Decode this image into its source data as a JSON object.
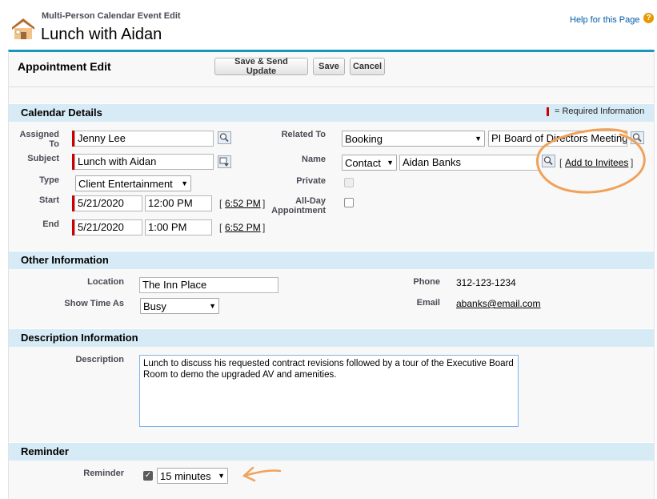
{
  "header": {
    "subtitle": "Multi-Person Calendar Event Edit",
    "title": "Lunch with Aidan",
    "help_link": "Help for this Page",
    "help_icon": "?"
  },
  "toolbar": {
    "title": "Appointment Edit",
    "save_send_label": "Save & Send Update",
    "save_label": "Save",
    "cancel_label": "Cancel"
  },
  "calendar_details": {
    "title": "Calendar Details",
    "required_legend": "= Required Information",
    "assigned_to_label": "Assigned To",
    "assigned_to_value": "Jenny Lee",
    "subject_label": "Subject",
    "subject_value": "Lunch with Aidan",
    "type_label": "Type",
    "type_value": "Client Entertainment",
    "start_label": "Start",
    "start_date": "5/21/2020",
    "start_time": "12:00 PM",
    "start_now": "6:52 PM",
    "end_label": "End",
    "end_date": "5/21/2020",
    "end_time": "1:00 PM",
    "end_now": "6:52 PM",
    "related_to_label": "Related To",
    "related_to_type": "Booking",
    "related_to_value": "PI Board of Directors Meeting",
    "name_label": "Name",
    "name_type": "Contact",
    "name_value": "Aidan Banks",
    "add_invitees": "Add to Invitees",
    "private_label": "Private",
    "all_day_label": "All-Day Appointment",
    "bracket_open": "[",
    "bracket_close": "]"
  },
  "other_information": {
    "title": "Other Information",
    "location_label": "Location",
    "location_value": "The Inn Place",
    "show_time_as_label": "Show Time As",
    "show_time_as_value": "Busy",
    "phone_label": "Phone",
    "phone_value": "312-123-1234",
    "email_label": "Email",
    "email_value": "abanks@email.com"
  },
  "description_information": {
    "title": "Description Information",
    "description_label": "Description",
    "description_value": "Lunch to discuss his requested contract revisions followed by a tour of the Executive Board Room to demo the upgraded AV and amenities."
  },
  "reminder": {
    "title": "Reminder",
    "reminder_label": "Reminder",
    "reminder_checked": true,
    "reminder_value": "15 minutes"
  },
  "colors": {
    "accent_bar": "#1797c0",
    "section_bg": "#d6ebf5",
    "required": "#cc0000",
    "annotation": "#f0a25a"
  }
}
